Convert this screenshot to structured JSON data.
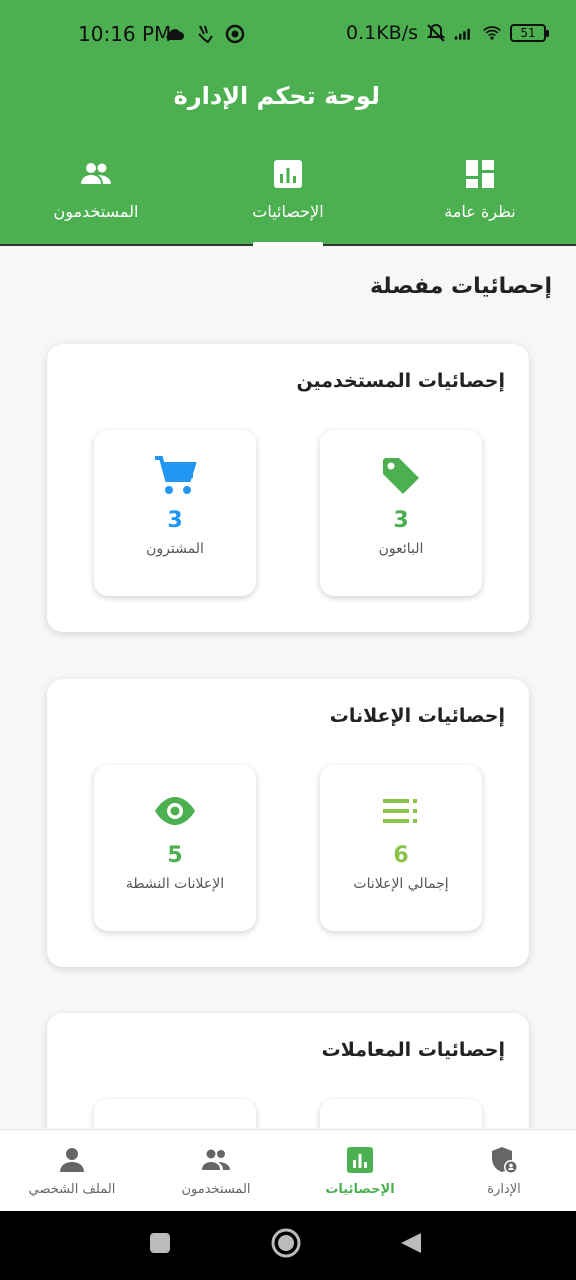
{
  "status_bar": {
    "time": "10:16 PM",
    "net_speed": "0.1KB/s",
    "battery": "51"
  },
  "app_bar": {
    "title": "لوحة تحكم الإدارة"
  },
  "top_tabs": [
    {
      "label": "نظرة عامة",
      "icon": "dashboard-icon"
    },
    {
      "label": "الإحصائيات",
      "icon": "bar-chart-icon",
      "active": true
    },
    {
      "label": "المستخدمون",
      "icon": "people-icon"
    }
  ],
  "page": {
    "section_title": "إحصائيات مفصلة"
  },
  "cards": [
    {
      "title": "إحصائيات المستخدمين",
      "stats": [
        {
          "label": "البائعون",
          "value": "3",
          "icon": "tag-icon",
          "color": "#4caf50"
        },
        {
          "label": "المشترون",
          "value": "3",
          "icon": "cart-icon",
          "color": "#2196f3"
        }
      ]
    },
    {
      "title": "إحصائيات الإعلانات",
      "stats": [
        {
          "label": "إجمالي الإعلانات",
          "value": "6",
          "icon": "list-icon",
          "color": "#8bc34a"
        },
        {
          "label": "الإعلانات النشطة",
          "value": "5",
          "icon": "eye-icon",
          "color": "#4caf50"
        }
      ]
    },
    {
      "title": "إحصائيات المعاملات"
    }
  ],
  "bottom_nav": [
    {
      "label": "الإدارة",
      "icon": "admin-shield-icon"
    },
    {
      "label": "الإحصائيات",
      "icon": "bar-chart-icon",
      "active": true
    },
    {
      "label": "المستخدمون",
      "icon": "people-icon"
    },
    {
      "label": "الملف الشخصي",
      "icon": "person-icon"
    }
  ],
  "colors": {
    "primary": "#4caf50",
    "blue": "#2196f3",
    "light_green": "#8bc34a"
  }
}
